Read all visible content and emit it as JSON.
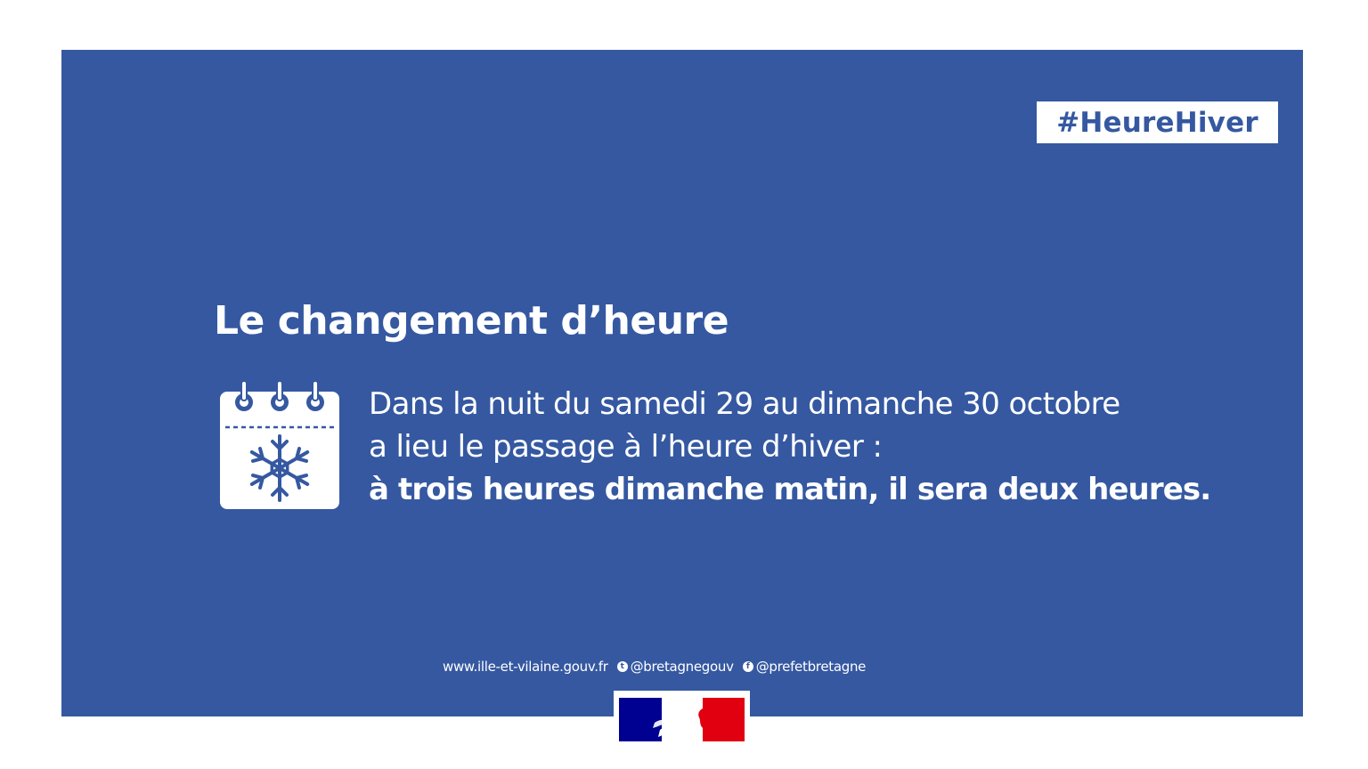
{
  "colors": {
    "panel": "#3558a1",
    "text": "#ffffff",
    "flag_blue": "#000091",
    "flag_red": "#e1000f"
  },
  "hashtag": "#HeureHiver",
  "title": "Le changement d’heure",
  "icon": "calendar-snowflake-icon",
  "body": {
    "line1": "Dans la nuit du samedi 29 au dimanche 30 octobre",
    "line2": "a lieu le passage à l’heure d’hiver :",
    "line3": "à trois heures dimanche matin, il sera deux heures."
  },
  "footer": {
    "website": "www.ille-et-vilaine.gouv.fr",
    "twitter": "@bretagnegouv",
    "facebook": "@prefetbretagne"
  },
  "logo": "marianne-republique-francaise-logo"
}
